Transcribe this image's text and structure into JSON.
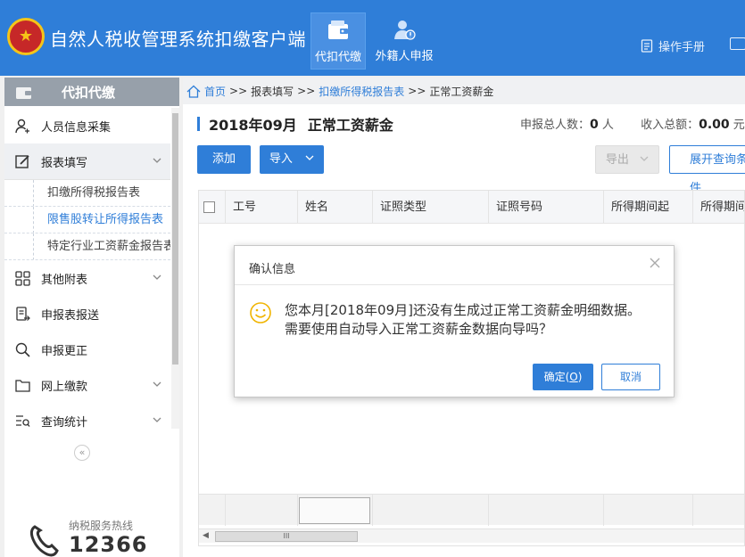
{
  "header": {
    "app_title": "自然人税收管理系统扣缴客户端",
    "nav": [
      {
        "label": "代扣代缴",
        "icon": "wallet-icon",
        "active": true
      },
      {
        "label": "外籍人申报",
        "icon": "foreign-person-icon",
        "active": false
      }
    ],
    "manual_label": "操作手册"
  },
  "sidebar": {
    "title": "代扣代缴",
    "items": [
      {
        "label": "人员信息采集",
        "icon": "person-icon"
      },
      {
        "label": "报表填写",
        "icon": "edit-icon",
        "expanded": true
      },
      {
        "label": "其他附表",
        "icon": "grid-icon"
      },
      {
        "label": "申报表报送",
        "icon": "report-send-icon"
      },
      {
        "label": "申报更正",
        "icon": "search-icon"
      },
      {
        "label": "网上缴款",
        "icon": "folder-icon"
      },
      {
        "label": "查询统计",
        "icon": "query-stats-icon"
      }
    ],
    "sub_items": [
      {
        "label": "扣缴所得税报告表"
      },
      {
        "label": "限售股转让所得报告表",
        "selected": true
      },
      {
        "label": "特定行业工资薪金报告表"
      }
    ],
    "hotline_label": "纳税服务热线",
    "hotline_number": "12366"
  },
  "breadcrumb": {
    "home": "首页",
    "sep": ">>",
    "level1": "报表填写",
    "level2": "扣缴所得税报告表",
    "current": "正常工资薪金"
  },
  "page": {
    "period": "2018年09月",
    "title_suffix": "正常工资薪金",
    "summary_count_label": "申报总人数：",
    "summary_count": "0",
    "summary_count_unit": "人",
    "summary_income_label": "收入总额：",
    "summary_income": "0.00",
    "summary_income_unit": "元"
  },
  "toolbar": {
    "add_label": "添加",
    "import_label": "导入",
    "export_label": "导出",
    "expand_label": "展开查询条件"
  },
  "table": {
    "columns": [
      "工号",
      "姓名",
      "证照类型",
      "证照号码",
      "所得期间起",
      "所得期间止"
    ],
    "scroll_grip": "III"
  },
  "modal": {
    "title": "确认信息",
    "message_line1": "您本月[2018年09月]还没有生成过正常工资薪金明细数据。",
    "message_line2": "需要使用自动导入正常工资薪金数据向导吗？",
    "ok_label": "确定",
    "ok_shortcut": "O",
    "cancel_label": "取消"
  },
  "colors": {
    "primary": "#2f7ed8",
    "header_bg": "#2f7ed8",
    "sidebar_head_bg": "#97a0aa"
  }
}
